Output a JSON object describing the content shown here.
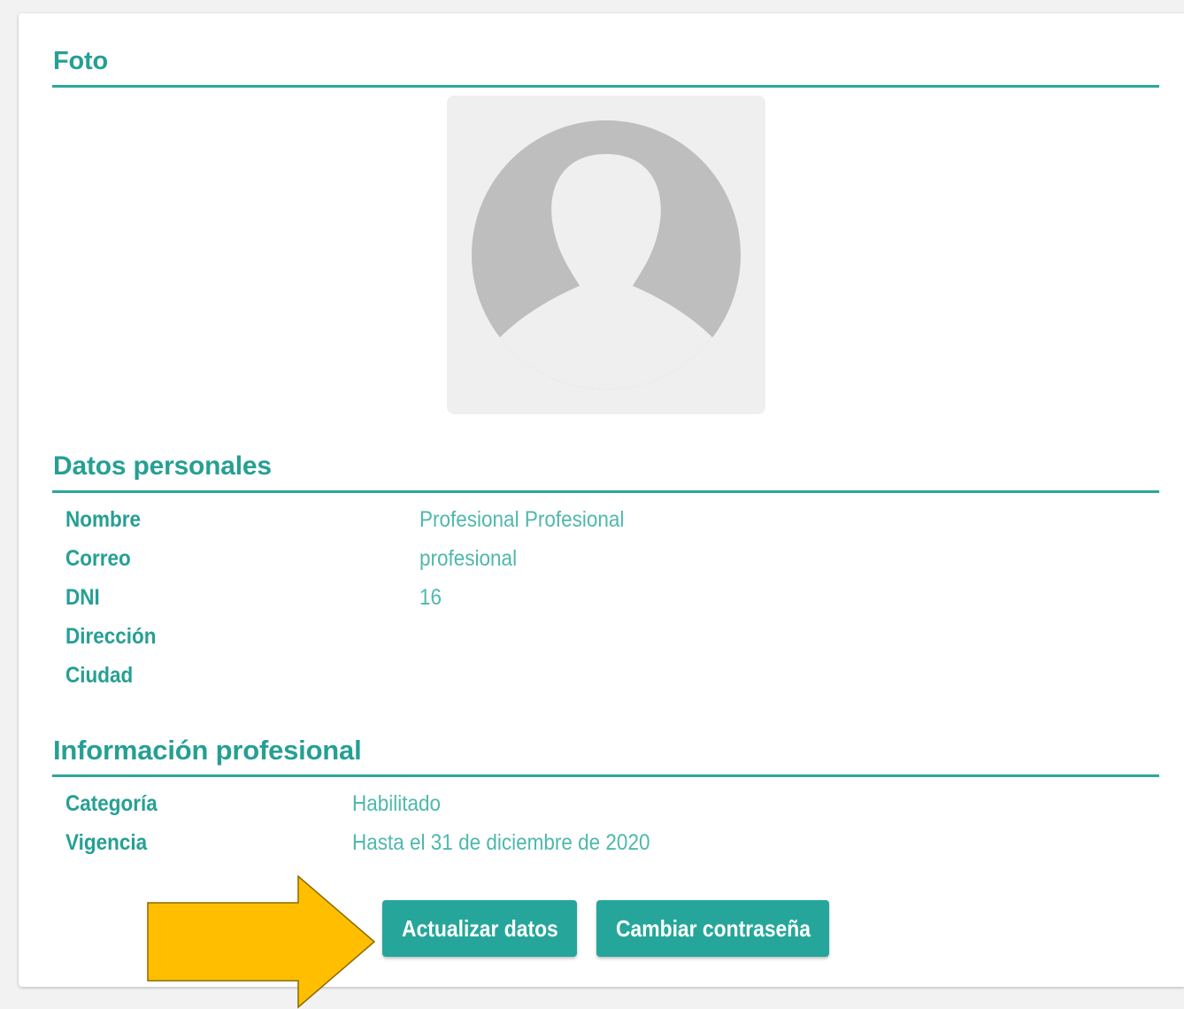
{
  "photo_section": {
    "title": "Foto",
    "avatar_icon": "default-avatar-icon"
  },
  "personal_section": {
    "title": "Datos personales",
    "fields": [
      {
        "label": "Nombre",
        "value": "Profesional Profesional"
      },
      {
        "label": "Correo",
        "value": "profesional"
      },
      {
        "label": "DNI",
        "value": "16"
      },
      {
        "label": "Dirección",
        "value": ""
      },
      {
        "label": "Ciudad",
        "value": ""
      }
    ]
  },
  "professional_section": {
    "title": "Información profesional",
    "fields": [
      {
        "label": "Categoría",
        "value": "Habilitado"
      },
      {
        "label": "Vigencia",
        "value": "Hasta el 31 de diciembre de 2020"
      }
    ]
  },
  "actions": {
    "update_label": "Actualizar datos",
    "change_password_label": "Cambiar contraseña"
  },
  "annotation": {
    "arrow_icon": "arrow-right-icon",
    "arrow_color": "#ffbf00"
  },
  "colors": {
    "accent": "#26a69a",
    "value_text": "#4fb8ad"
  }
}
